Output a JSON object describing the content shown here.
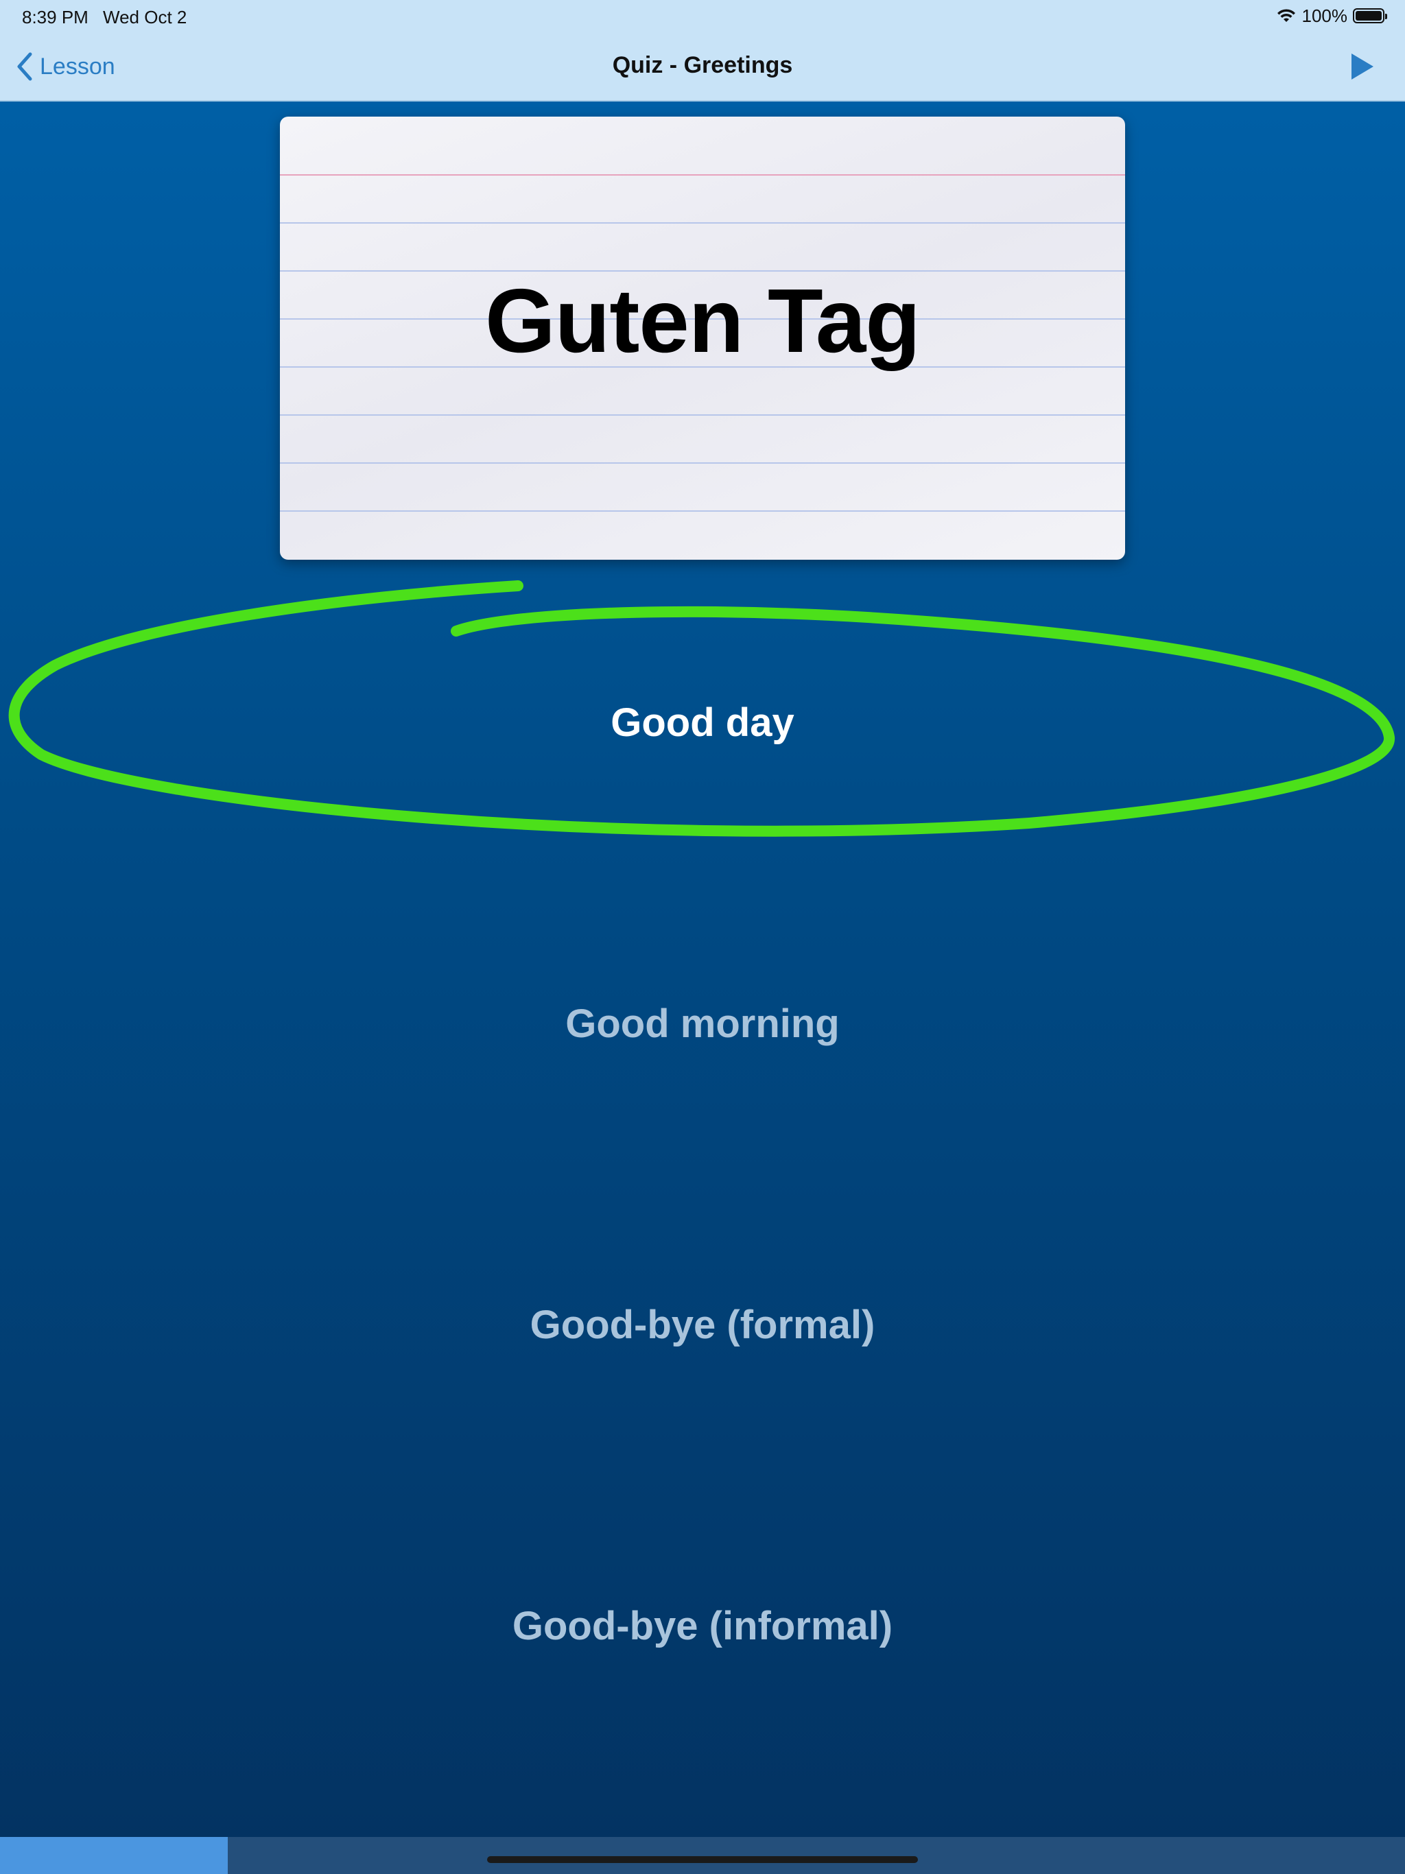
{
  "status_bar": {
    "time": "8:39 PM",
    "date": "Wed Oct 2",
    "battery_percent": "100%",
    "wifi_icon": "wifi-icon",
    "battery_icon": "battery-icon"
  },
  "nav": {
    "back_label": "Lesson",
    "back_icon": "chevron-left-icon",
    "title": "Quiz - Greetings",
    "play_icon": "play-icon"
  },
  "card": {
    "word": "Guten Tag"
  },
  "answers": [
    {
      "label": "Good day",
      "selected": true
    },
    {
      "label": "Good morning",
      "selected": false
    },
    {
      "label": "Good-bye (formal)",
      "selected": false
    },
    {
      "label": "Good-bye (informal)",
      "selected": false
    }
  ],
  "progress": {
    "fraction": 0.162
  },
  "colors": {
    "accent": "#2a7dc4",
    "highlight_stroke": "#4ce01a",
    "answer_text": "#a9c4dc",
    "selected_text": "#ffffff"
  }
}
